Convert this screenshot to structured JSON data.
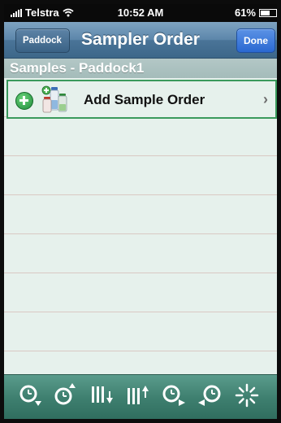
{
  "statusbar": {
    "carrier": "Telstra",
    "time": "10:52 AM",
    "battery_text": "61%",
    "battery_level": 0.61
  },
  "navbar": {
    "back_label": "Paddock",
    "title": "Sampler Order",
    "done_label": "Done"
  },
  "section": {
    "header": "Samples - Paddock1"
  },
  "table": {
    "add_row_label": "Add Sample Order"
  },
  "toolbar": {
    "icons": [
      "zoom-down-icon",
      "zoom-up-icon",
      "sort-down-icon",
      "sort-up-icon",
      "zoom-right-icon",
      "zoom-left-icon",
      "spinner-icon"
    ]
  },
  "colors": {
    "nav_bar": "#4a7498",
    "done_button": "#2a68d1",
    "table_bg": "#e6f1ec",
    "toolbar": "#3f8070",
    "selected_border": "#3a9a5c"
  }
}
